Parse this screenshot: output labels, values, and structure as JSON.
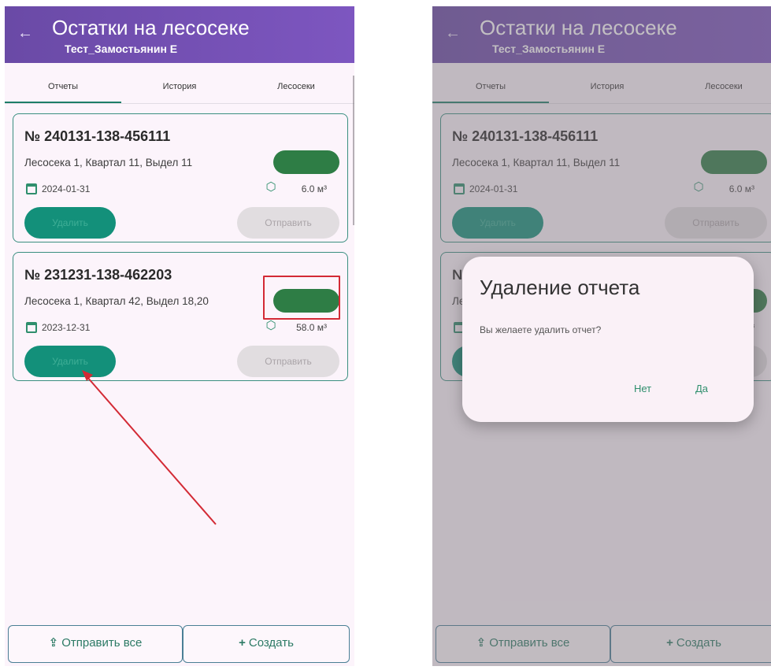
{
  "screen": {
    "title": "Остатки на лесосеке",
    "subtitle": "Тест_Замостьянин Е",
    "tabs": [
      "Отчеты",
      "История",
      "Лесосеки"
    ],
    "active_tab": 0
  },
  "reports": [
    {
      "number": "№ 240131-138-456111",
      "location": "Лесосека 1, Квартал 11, Выдел 11",
      "date": "2024-01-31",
      "volume": "6.0 м³",
      "delete_label": "Удалить",
      "send_label": "Отправить",
      "status_color": "#2e7d45"
    },
    {
      "number": "№ 231231-138-462203",
      "location": "Лесосека 1, Квартал 42, Выдел 18,20",
      "date": "2023-12-31",
      "volume": "58.0 м³",
      "delete_label": "Удалить",
      "send_label": "Отправить",
      "status_color": "#2e7d45"
    }
  ],
  "bottom": {
    "send_all_label": "Отправить все",
    "send_all_icon": "upload-icon",
    "create_label": "Создать",
    "create_icon": "plus-icon"
  },
  "dialog": {
    "title": "Удаление отчета",
    "message": "Вы желаете удалить отчет?",
    "no_label": "Нет",
    "yes_label": "Да"
  },
  "colors": {
    "appbar": "#6a4aa6",
    "accent": "#13907a",
    "annotation": "#d32a35"
  }
}
